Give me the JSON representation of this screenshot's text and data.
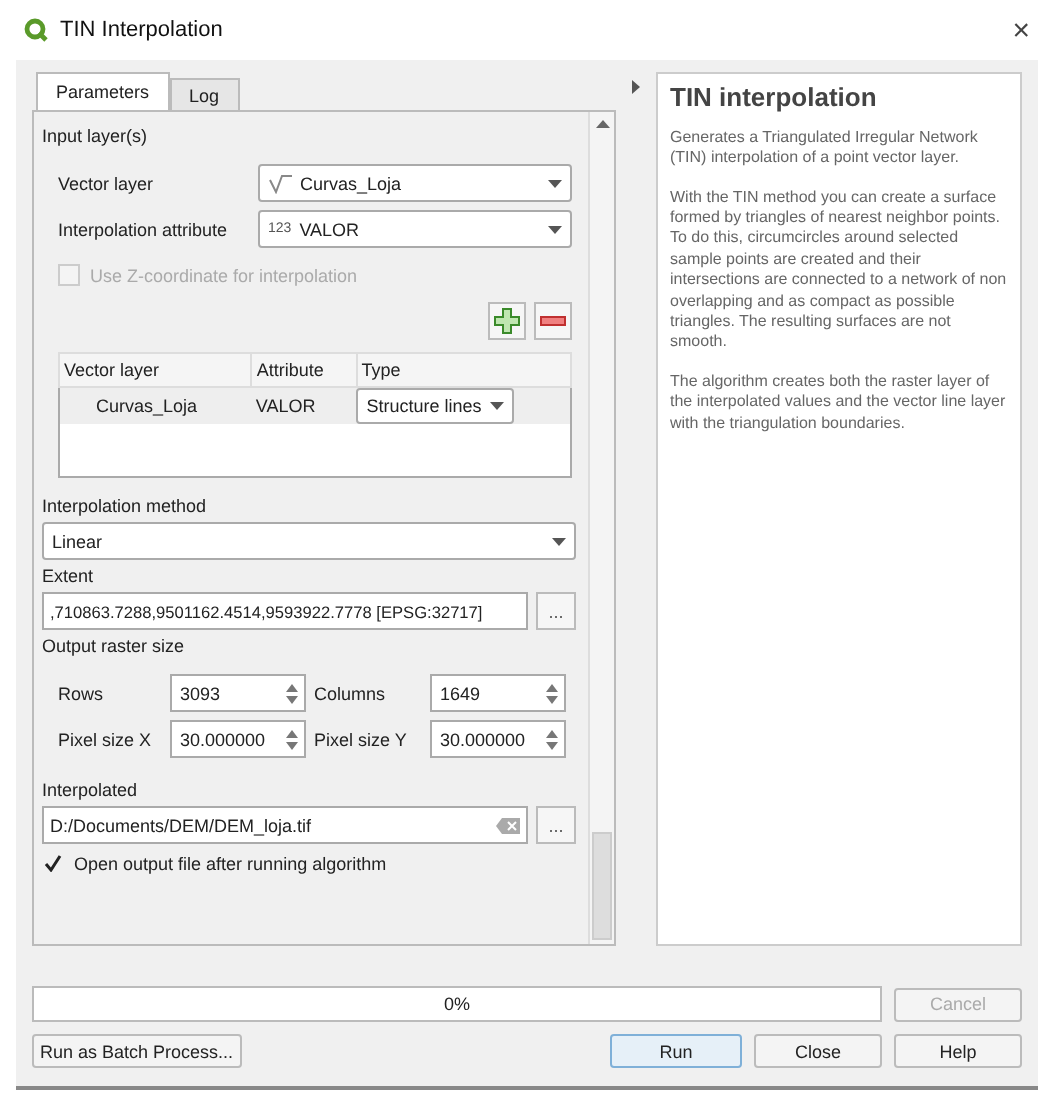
{
  "window": {
    "title": "TIN Interpolation",
    "close": "×"
  },
  "tabs": [
    {
      "label": "Parameters",
      "selected": true
    },
    {
      "label": "Log",
      "selected": false
    }
  ],
  "parameters": {
    "input_section": {
      "label": "Input layer(s)",
      "vector_layer": {
        "label": "Vector layer",
        "value": "Curvas_Loja"
      },
      "interpolation_attribute": {
        "label": "Interpolation attribute",
        "type_badge": "123",
        "value": "VALOR"
      },
      "use_z": {
        "label": "Use Z-coordinate for interpolation",
        "checked": false,
        "disabled": true
      },
      "table": {
        "columns": [
          "Vector layer",
          "Attribute",
          "Type"
        ],
        "rows": [
          {
            "vector_layer": "Curvas_Loja",
            "attribute": "VALOR",
            "type": "Structure lines"
          }
        ]
      }
    },
    "interpolation_method": {
      "label": "Interpolation method",
      "value": "Linear"
    },
    "extent": {
      "label": "Extent",
      "value": ",710863.7288,9501162.4514,9593922.7778 [EPSG:32717]",
      "button": "..."
    },
    "output_raster_size": {
      "label": "Output raster size",
      "fields": [
        {
          "label": "Rows",
          "value": "3093"
        },
        {
          "label": "Columns",
          "value": "1649"
        },
        {
          "label": "Pixel size X",
          "value": "30.000000"
        },
        {
          "label": "Pixel size Y",
          "value": "30.000000"
        }
      ]
    },
    "interpolated": {
      "label": "Interpolated",
      "value": "D:/Documents/DEM/DEM_loja.tif",
      "button": "..."
    },
    "open_output": {
      "label": "Open output file after running algorithm",
      "checked": true
    }
  },
  "help": {
    "title": "TIN interpolation",
    "paragraphs": [
      "Generates a Triangulated Irregular Network (TIN) interpolation of a point vector layer.",
      "With the TIN method you can create a surface formed by triangles of nearest neighbor points. To do this, circumcircles around selected sample points are created and their intersections are connected to a network of non overlapping and as compact as possible triangles. The resulting surfaces are not smooth.",
      "The algorithm creates both the raster layer of the interpolated values and the vector line layer with the triangulation boundaries."
    ]
  },
  "progress": {
    "label": "0%",
    "level": 0
  },
  "cancel_button": {
    "label": "Cancel",
    "disabled": true
  },
  "batch_button": {
    "label": "Run as Batch Process..."
  },
  "buttons": [
    {
      "label": "Run",
      "default": true
    },
    {
      "label": "Close",
      "default": false
    },
    {
      "label": "Help",
      "default": false
    }
  ]
}
